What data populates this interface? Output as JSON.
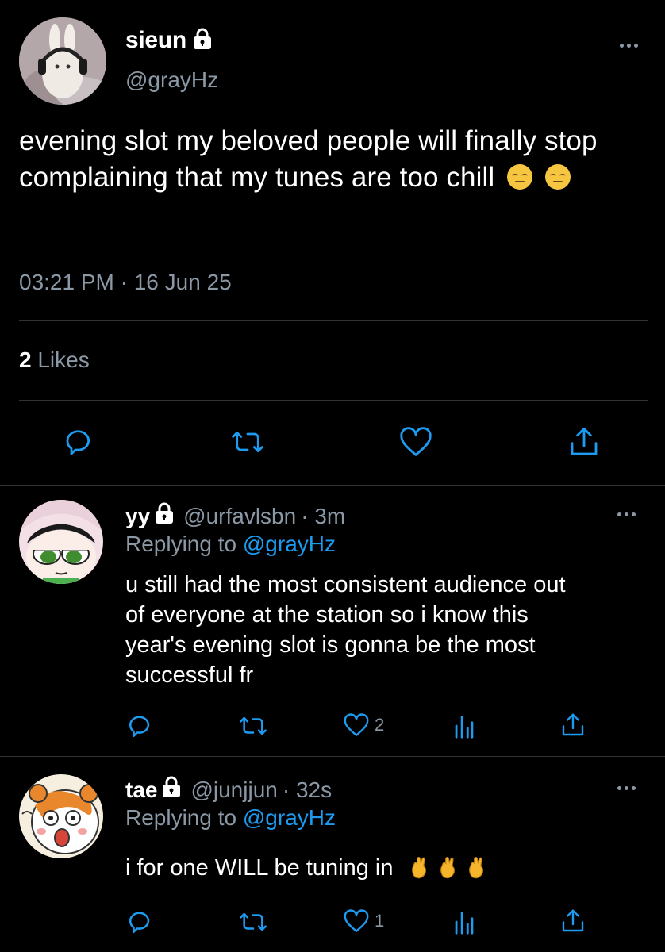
{
  "main_tweet": {
    "name": "sieun",
    "handle": "@grayHz",
    "text": "evening slot my beloved people will finally stop complaining that my tunes are too chill",
    "emoji": [
      "pensive-face",
      "pensive-face"
    ],
    "timestamp": "03:21 PM · 16 Jun 25",
    "likes_count": "2",
    "likes_label": "Likes"
  },
  "replies": [
    {
      "name": "yy",
      "handle": "@urfavlsbn",
      "time": "· 3m",
      "replying_prefix": "Replying to",
      "replying_to": "@grayHz",
      "text_lines": [
        "u still had the most consistent audience out",
        "of everyone at the station so i know this",
        "year's evening slot is gonna be the most",
        "successful fr"
      ],
      "like_count": "2",
      "avatar": "buttercup-avatar"
    },
    {
      "name": "tae",
      "handle": "@junjjun",
      "time": "· 32s",
      "replying_prefix": "Replying to",
      "replying_to": "@grayHz",
      "text": "i for one WILL be tuning in",
      "emoji": [
        "crossed-fingers",
        "crossed-fingers",
        "crossed-fingers"
      ],
      "like_count": "1",
      "avatar": "hamtaro-avatar"
    }
  ],
  "colors": {
    "background": "#000000",
    "text": "#ffffff",
    "secondary": "#8b98a5",
    "link": "#1d9bf0",
    "divider": "#2f3336"
  }
}
